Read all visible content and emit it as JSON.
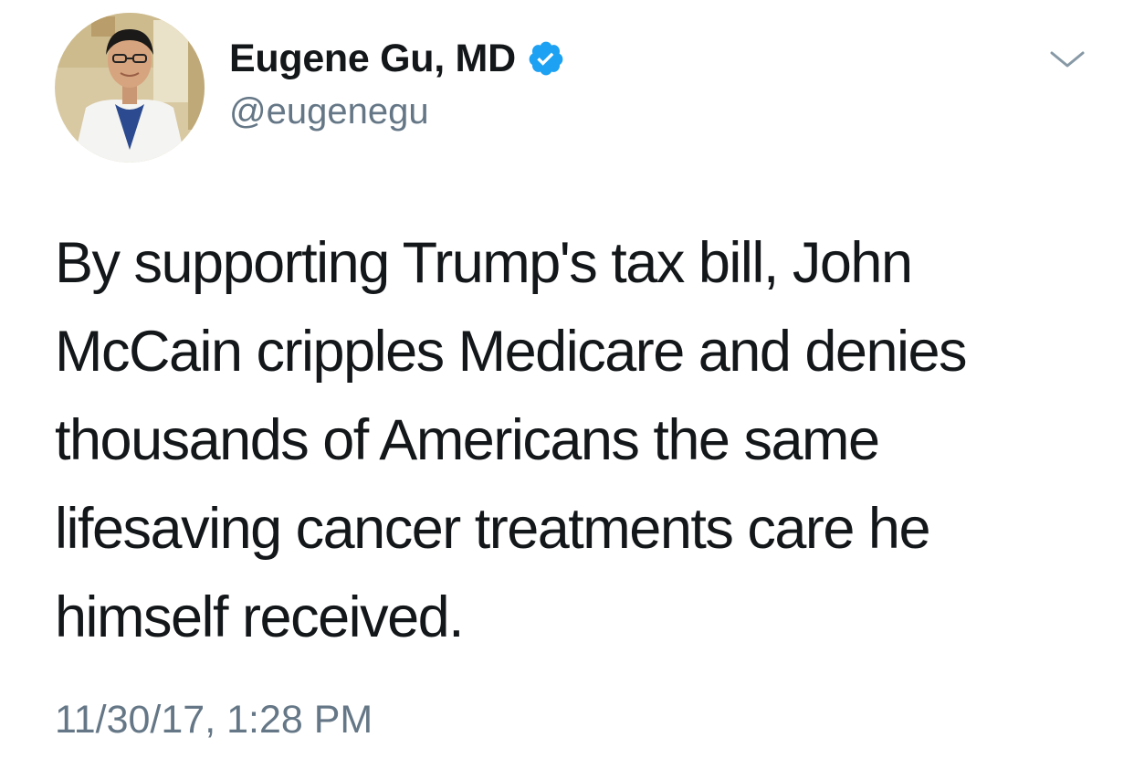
{
  "tweet": {
    "author": {
      "display_name": "Eugene Gu, MD",
      "handle": "@eugenegu",
      "verified": true
    },
    "body_lines": [
      "By supporting Trump's tax bill, John",
      "McCain cripples Medicare and denies",
      "thousands of Americans the same",
      "lifesaving cancer treatments care he",
      "himself received."
    ],
    "timestamp": "11/30/17, 1:28 PM"
  },
  "icons": {
    "verified": "verified-badge-icon",
    "menu": "chevron-down-icon"
  },
  "colors": {
    "text_primary": "#14171a",
    "text_secondary": "#657786",
    "verified_blue": "#1da1f2",
    "caret": "#8899a6"
  }
}
